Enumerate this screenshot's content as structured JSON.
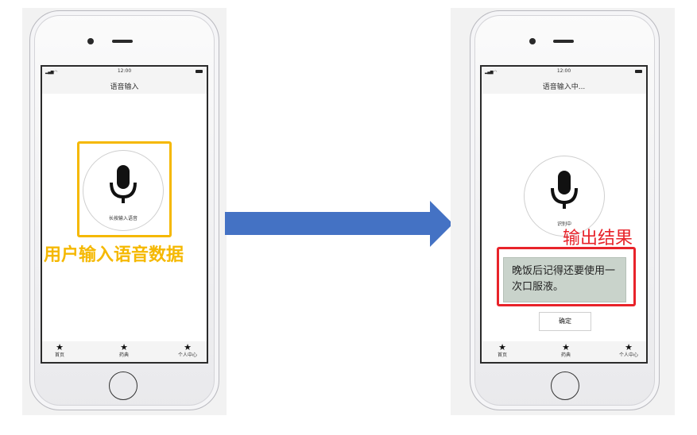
{
  "left_phone": {
    "status_time": "12:00",
    "nav_title": "语音输入",
    "mic_label": "长按输入语音",
    "tabs": [
      {
        "label": "首页"
      },
      {
        "label": "药典"
      },
      {
        "label": "个人中心"
      }
    ]
  },
  "left_caption": "用户输入语音数据",
  "right_phone": {
    "status_time": "12:00",
    "nav_title": "语音输入中...",
    "mic_label": "识别中",
    "result_text": "晚饭后记得还要使用一次口服液。",
    "confirm_label": "确定",
    "tabs": [
      {
        "label": "首页"
      },
      {
        "label": "药典"
      },
      {
        "label": "个人中心"
      }
    ]
  },
  "right_caption": "输出结果",
  "colors": {
    "arrow": "#4472c4",
    "highlight_input": "#f5b800",
    "highlight_output": "#e8232a",
    "bubble": "#c9d3cb"
  },
  "icons": {
    "mic": "microphone-icon",
    "tab": "star-icon",
    "flow": "right-arrow-icon"
  }
}
